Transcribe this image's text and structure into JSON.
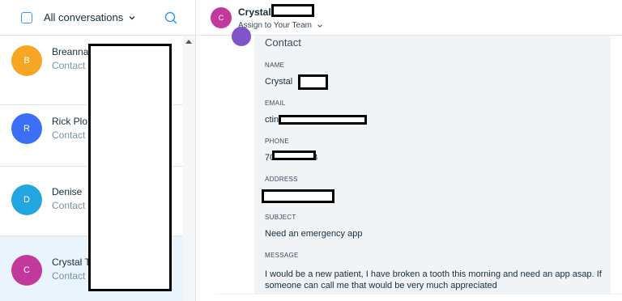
{
  "left_header": {
    "filter_label": "All conversations"
  },
  "conversations": [
    {
      "initial": "B",
      "name": "Breanna",
      "type": "Contact",
      "color": "#f5a623"
    },
    {
      "initial": "R",
      "name": "Rick Plo",
      "type": "Contact",
      "color": "#3b6ff5"
    },
    {
      "initial": "D",
      "name": "Denise",
      "type": "Contact",
      "color": "#23a6e0"
    },
    {
      "initial": "C",
      "name": "Crystal T",
      "type": "Contact",
      "color": "#c2389b"
    }
  ],
  "header": {
    "initial": "C",
    "name": "Crystal",
    "assign": "Assign to Your Team"
  },
  "card": {
    "title": "Contact",
    "name_label": "NAME",
    "name_value": "Crystal",
    "email_label": "EMAIL",
    "email_value": "ctin",
    "phone_label": "PHONE",
    "phone_value_start": "70",
    "phone_value_end": "3",
    "address_label": "ADDRESS",
    "subject_label": "SUBJECT",
    "subject_value": "Need an emergency app",
    "message_label": "MESSAGE",
    "message_value": "I would be a new patient, I have broken a tooth this morning and need an app asap. If someone can call me that would be very much appreciated"
  }
}
